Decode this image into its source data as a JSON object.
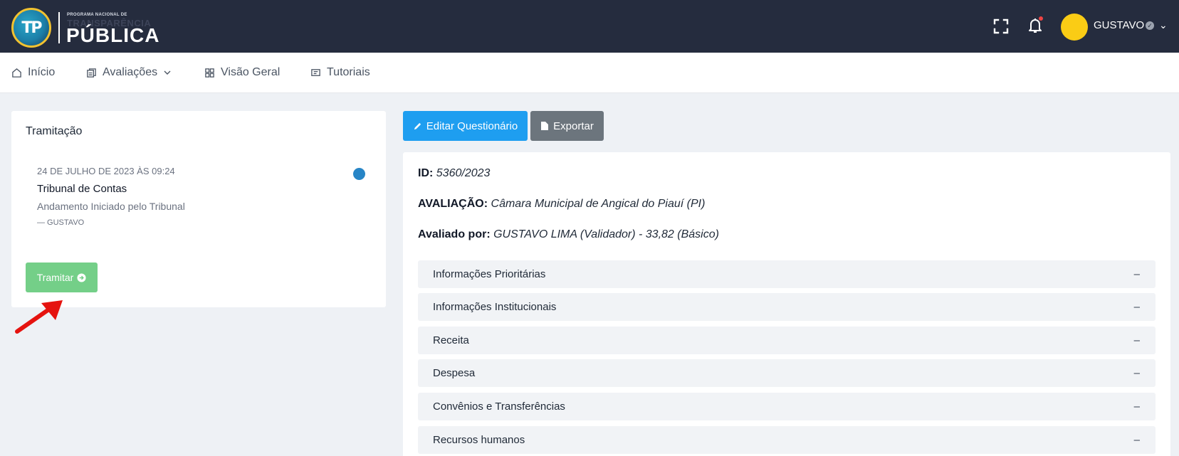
{
  "header": {
    "logo_mark": "TP",
    "logo_small": "PROGRAMA NACIONAL DE",
    "logo_shadow": "TRANSPARÊNCIA",
    "logo_big": "PÚBLICA",
    "user_name": "GUSTAVO",
    "icons": {
      "expand": "fullscreen-icon",
      "notifications": "bell-icon",
      "verified": "check-circle-icon",
      "menu": "chevron-down-icon"
    },
    "colors": {
      "bar": "#252c3e",
      "avatar": "#facc15",
      "notification_dot": "#ef4444"
    }
  },
  "nav": {
    "items": [
      {
        "label": "Início",
        "icon": "home-icon"
      },
      {
        "label": "Avaliações",
        "icon": "copy-icon"
      },
      {
        "label": "Visão Geral",
        "icon": "grid-icon"
      },
      {
        "label": "Tutoriais",
        "icon": "video-icon"
      }
    ]
  },
  "tramitacao": {
    "title": "Tramitação",
    "entry": {
      "date": "24 DE JULHO DE 2023 ÀS 09:24",
      "title": "Tribunal de Contas",
      "description": "Andamento Iniciado pelo Tribunal",
      "user": "— GUSTAVO"
    },
    "button_label": "Tramitar",
    "colors": {
      "dot": "#2785c6",
      "button": "#74cf88",
      "arrow": "#e5130f"
    }
  },
  "actions": {
    "edit_label": "Editar Questionário",
    "export_label": "Exportar",
    "colors": {
      "edit": "#1e9ef0",
      "export": "#6c757d"
    }
  },
  "details": {
    "id_label": "ID:",
    "id_value": "5360/2023",
    "avaliacao_label": "AVALIAÇÃO:",
    "avaliacao_value": "Câmara Municipal de Angical do Piauí (PI)",
    "avaliado_label": "Avaliado por:",
    "avaliado_value": "GUSTAVO LIMA (Validador) - 33,82 (Básico)"
  },
  "sections": [
    {
      "label": "Informações Prioritárias",
      "toggle": "–"
    },
    {
      "label": "Informações Institucionais",
      "toggle": "–"
    },
    {
      "label": "Receita",
      "toggle": "–"
    },
    {
      "label": "Despesa",
      "toggle": "–"
    },
    {
      "label": "Convênios e Transferências",
      "toggle": "–"
    },
    {
      "label": "Recursos humanos",
      "toggle": "–"
    }
  ]
}
